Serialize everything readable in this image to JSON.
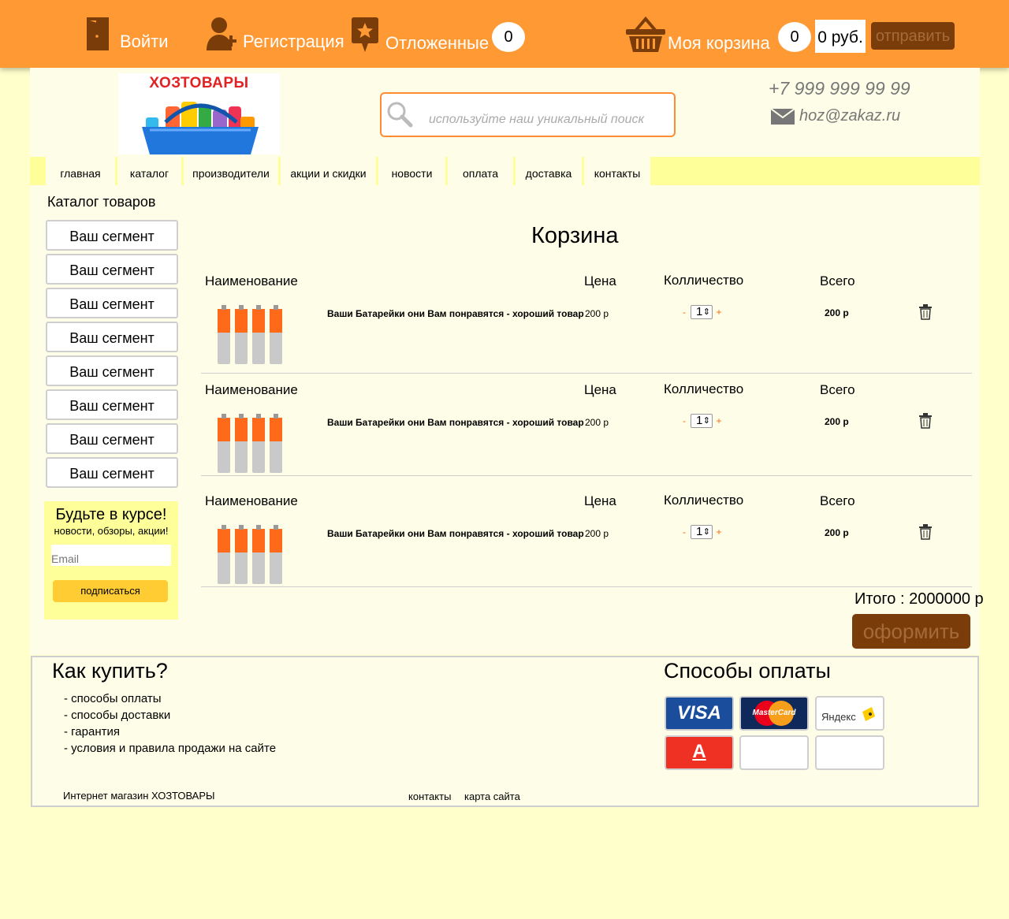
{
  "topbar": {
    "login_label": "Войти",
    "register_label": "Регистрация",
    "deferred_label": "Отложенные",
    "deferred_count": "0",
    "cart_label": "Моя корзина",
    "cart_count": "0",
    "cart_sum": "0 руб.",
    "send_label": "отправить"
  },
  "header": {
    "logo_text": "ХОЗТОВАРЫ",
    "search_placeholder": "используйте наш уникальный поиск",
    "phone": "+7 999 999 99 99",
    "email": "hoz@zakaz.ru"
  },
  "nav": [
    "главная",
    "каталог",
    "производители",
    "акции и скидки",
    "новости",
    "оплата",
    "доставка",
    "контакты"
  ],
  "sidebar": {
    "title": "Каталог товаров",
    "segments": [
      "Ваш сегмент",
      "Ваш сегмент",
      "Ваш сегмент",
      "Ваш сегмент",
      "Ваш сегмент",
      "Ваш сегмент",
      "Ваш сегмент",
      "Ваш сегмент"
    ],
    "news_title": "Будьте в курсе!",
    "news_sub": "новости, обзоры, акции!",
    "email_placeholder": "Email",
    "subscribe_label": "подписаться"
  },
  "cart": {
    "title": "Корзина",
    "headers": {
      "name": "Наименование",
      "price": "Цена",
      "qty": "Колличество",
      "total": "Всего"
    },
    "items": [
      {
        "name": "Ваши Батарейки они Вам понравятся - хороший товар",
        "price": "200 р",
        "qty": "1",
        "total": "200 р"
      },
      {
        "name": "Ваши Батарейки они Вам понравятся - хороший товар",
        "price": "200 р",
        "qty": "1",
        "total": "200 р"
      },
      {
        "name": "Ваши Батарейки они Вам понравятся - хороший товар",
        "price": "200 р",
        "qty": "1",
        "total": "200 р"
      }
    ],
    "minus": "-",
    "plus": "+",
    "grand_total": "Итого : 2000000 р",
    "checkout_label": "оформить"
  },
  "footer": {
    "how_title": "Как купить?",
    "how_items": [
      "- способы оплаты",
      "- способы доставки",
      "- гарантия",
      "- условия и правила продажи на сайте"
    ],
    "shop_name": "Интернет магазин ХОЗТОВАРЫ",
    "links": [
      "контакты",
      "карта сайта"
    ],
    "pay_title": "Способы оплаты",
    "pay_visa": "VISA",
    "pay_mastercard": "MasterCard",
    "pay_yandex": "Яндекс",
    "pay_alfa": "А"
  },
  "colors": {
    "topbar": "#ff9933",
    "accent_dark": "#7a3d0a",
    "page_bg": "#ffffcc",
    "nav_bg": "#ffff99"
  }
}
